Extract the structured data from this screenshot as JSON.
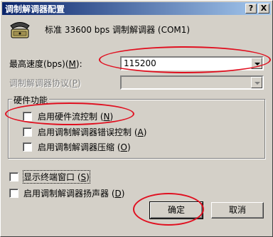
{
  "window": {
    "title": "调制解调器配置",
    "help_btn": "?",
    "close_btn": "X"
  },
  "modem": {
    "icon": "modem-phone-icon",
    "name": "标准 33600 bps 调制解调器 (COM1)"
  },
  "max_speed": {
    "label": "最高速度(bps)(",
    "key": "M",
    "label_end": "):",
    "value": "115200"
  },
  "protocol": {
    "label": "调制解调器协议(",
    "key": "P",
    "label_end": ")",
    "value": ""
  },
  "hardware": {
    "group_title": "硬件功能",
    "options": [
      {
        "text": "启用硬件流控制 (",
        "key": "N",
        "end": ")",
        "checked": false
      },
      {
        "text": "启用调制解调器错误控制 (",
        "key": "A",
        "end": ")",
        "checked": false
      },
      {
        "text": "启用调制解调器压缩 (",
        "key": "O",
        "end": ")",
        "checked": false
      }
    ]
  },
  "terminal": {
    "text": "显示终端窗口 (",
    "key": "S",
    "end": ")",
    "checked": false
  },
  "speaker": {
    "text": "启用调制解调器扬声器 (",
    "key": "D",
    "end": ")",
    "checked": false
  },
  "buttons": {
    "ok": "确定",
    "cancel": "取消"
  },
  "colors": {
    "titlebar_start": "#0a246a",
    "titlebar_end": "#a6caf0",
    "annotation_red": "#e01020",
    "dialog_bg": "#d4d0c8"
  }
}
